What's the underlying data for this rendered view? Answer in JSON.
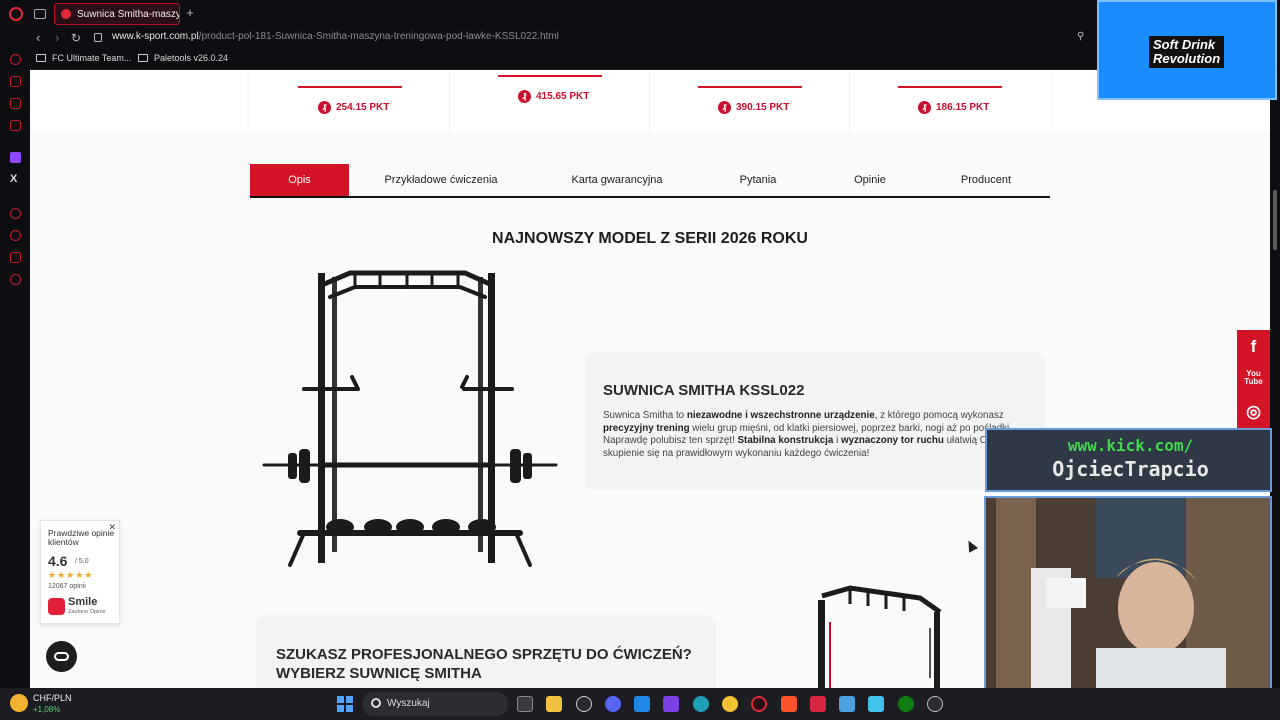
{
  "browser": {
    "tab_title": "Suwnica Smitha-maszyna",
    "url_host": "www.k-sport.com.pl",
    "url_path": "/product-pol-181-Suwnica-Smitha-maszyna-treningowa-pod-lawke-KSSL022.html",
    "bookmarks": [
      "FC Ultimate Team...",
      "Paletools v26.0.24"
    ]
  },
  "prices": [
    "254.15 PKT",
    "415.65 PKT",
    "390.15 PKT",
    "186.15 PKT"
  ],
  "coin_symbol": "₰",
  "tabs": [
    "Opis",
    "Przykładowe ćwiczenia",
    "Karta gwarancyjna",
    "Pytania",
    "Opinie",
    "Producent"
  ],
  "main": {
    "heading": "NAJNOWSZY MODEL Z SERII 2026 ROKU",
    "product_title": "SUWNICA SMITHA KSSL022",
    "desc": {
      "p1": "Suwnica Smitha to ",
      "b1": "niezawodne i wszechstronne urządzenie",
      "p2": ", z którego pomocą wykonasz ",
      "b2": "precyzyjny trening",
      "p3": " wielu grup mięśni, od klatki piersiowej, poprzez barki, nogi aż po pośladki. Naprawdę polubisz ten sprzęt! ",
      "b3": "Stabilna konstrukcja",
      "p4": " i ",
      "b4": "wyznaczony tor ruchu",
      "p5": " ułatwią Ci skupienie się na prawidłowym wykonaniu każdego ćwiczenia!"
    },
    "card2_title": "SZUKASZ PROFESJONALNEGO SPRZĘTU DO ĆWICZEŃ? WYBIERZ SUWNICĘ SMITHA"
  },
  "trust": {
    "title": "Prawdziwe opinie klientów",
    "score": "4.6",
    "scale": "/ 5.0",
    "stars": "★★★★★",
    "count": "12067 opinii",
    "brand": "Smile",
    "brand_sub": "Zaufane Opinie"
  },
  "social": [
    "f",
    "You Tube",
    "◎"
  ],
  "overlay": {
    "sd_line1": "Soft Drink",
    "sd_line2": "Revolution",
    "kick_line1": "www.kick.com/",
    "kick_line2": "OjciecTrapcio"
  },
  "taskbar": {
    "currency": "CHF/PLN",
    "change": "+1,08%",
    "search": "Wyszukaj"
  },
  "colors": {
    "accent": "#d31427",
    "chrome": "#0e0e12"
  }
}
